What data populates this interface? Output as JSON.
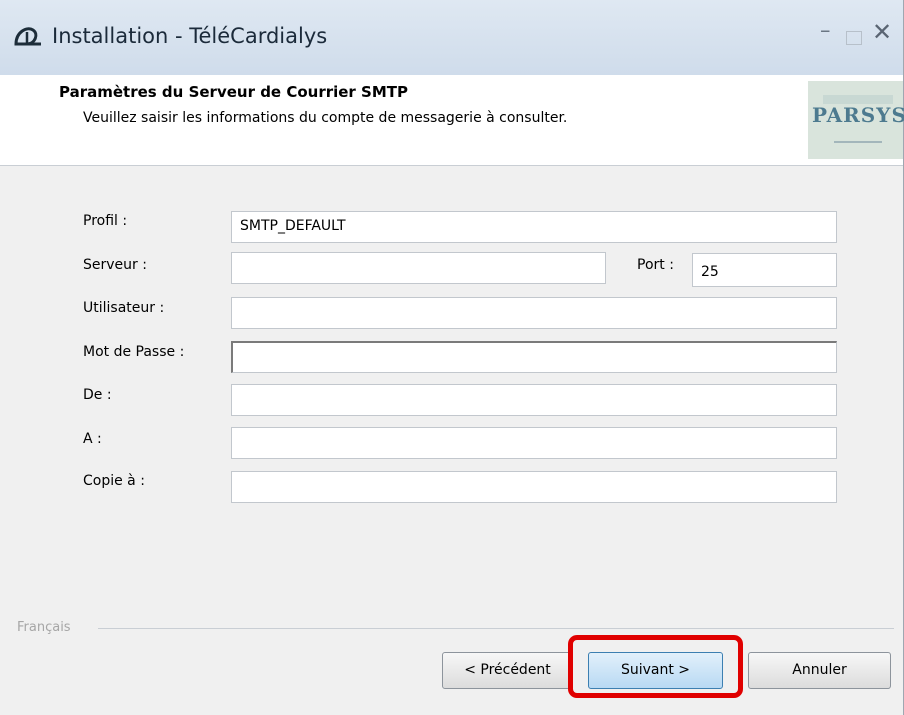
{
  "window": {
    "title": "Installation - TéléCardialys"
  },
  "header": {
    "title": "Paramètres du Serveur de Courrier SMTP",
    "subtitle": "Veuillez saisir les informations du compte de messagerie à consulter.",
    "logo_text": "PARSYS"
  },
  "form": {
    "profil_label": "Profil :",
    "profil_value": "SMTP_DEFAULT",
    "serveur_label": "Serveur :",
    "serveur_value": "",
    "port_label": "Port :",
    "port_value": "25",
    "utilisateur_label": "Utilisateur :",
    "utilisateur_value": "",
    "motdepasse_label": "Mot de Passe :",
    "motdepasse_value": "",
    "de_label": "De :",
    "de_value": "",
    "a_label": "A :",
    "a_value": "",
    "copie_label": "Copie à :",
    "copie_value": ""
  },
  "footer": {
    "language": "Français",
    "prev_label": "< Précédent",
    "next_label": "Suivant >",
    "cancel_label": "Annuler"
  },
  "colors": {
    "highlight": "#e00000",
    "accent": "#3c7fb1"
  }
}
